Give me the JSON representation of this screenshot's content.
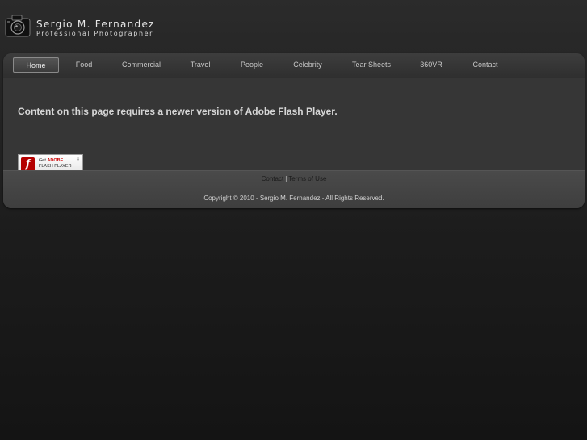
{
  "header": {
    "name": "Sergio M. Fernandez",
    "tagline": "Professional Photographer",
    "icon": "camera-icon"
  },
  "nav": {
    "items": [
      {
        "label": "Home",
        "active": true
      },
      {
        "label": "Food"
      },
      {
        "label": "Commercial"
      },
      {
        "label": "Travel"
      },
      {
        "label": "People"
      },
      {
        "label": "Celebrity"
      },
      {
        "label": "Tear Sheets"
      },
      {
        "label": "360VR"
      },
      {
        "label": "Contact"
      }
    ]
  },
  "content": {
    "flash_message": "Content on this page requires a newer version of Adobe Flash Player.",
    "badge": {
      "icon": "flash-logo-icon",
      "get": "Get",
      "adobe": "ADOBE",
      "player": "FLASH PLAYER"
    }
  },
  "footer": {
    "links": [
      "Contact",
      "Terms of Use"
    ],
    "separator": "|",
    "copyright": "Copyright © 2010 - Sergio M. Fernandez - All Rights Reserved."
  },
  "colors": {
    "background": "#1c1c1c",
    "panel": "#363636",
    "flash_red": "#b40000"
  }
}
